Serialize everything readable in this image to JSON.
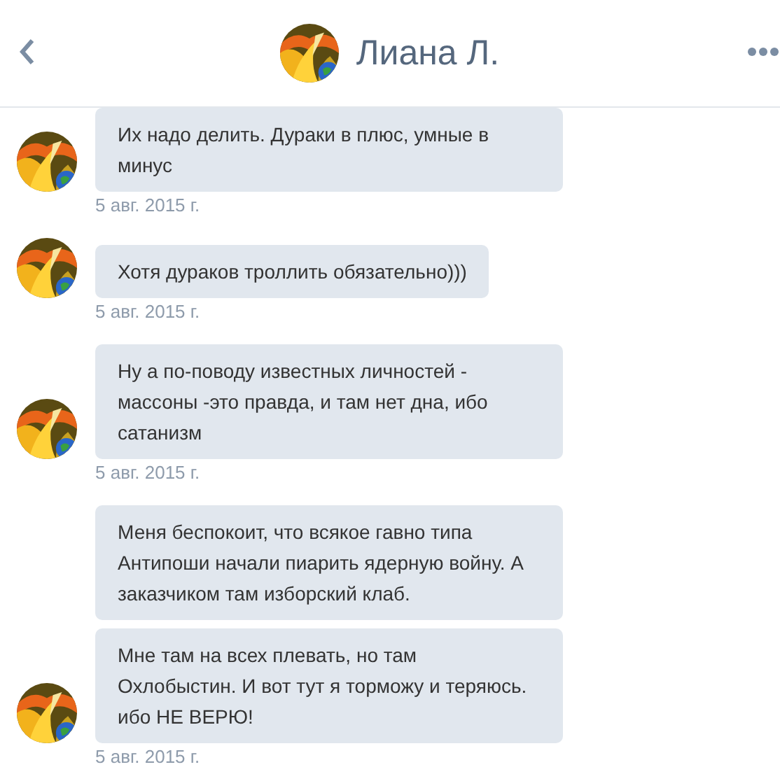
{
  "header": {
    "title": "Лиана Л."
  },
  "groups": [
    {
      "messages": [
        "Их надо делить. Дураки в плюс, умные в минус"
      ],
      "date": "5 авг. 2015 г."
    },
    {
      "messages": [
        "Хотя дураков троллить обязательно)))"
      ],
      "date": "5 авг. 2015 г."
    },
    {
      "messages": [
        "Ну а по-поводу известных личностей - массоны -это правда, и там нет дна, ибо сатанизм"
      ],
      "date": "5 авг. 2015 г."
    },
    {
      "messages": [
        "Меня беспокоит, что всякое гавно типа Антипоши начали пиарить ядерную войну. А заказчиком там изборский клаб.",
        "Мне там на всех плевать, но там Охлобыстин. И вот тут я торможу и теряюсь. ибо НЕ ВЕРЮ!"
      ],
      "date": "5 авг. 2015 г."
    }
  ]
}
